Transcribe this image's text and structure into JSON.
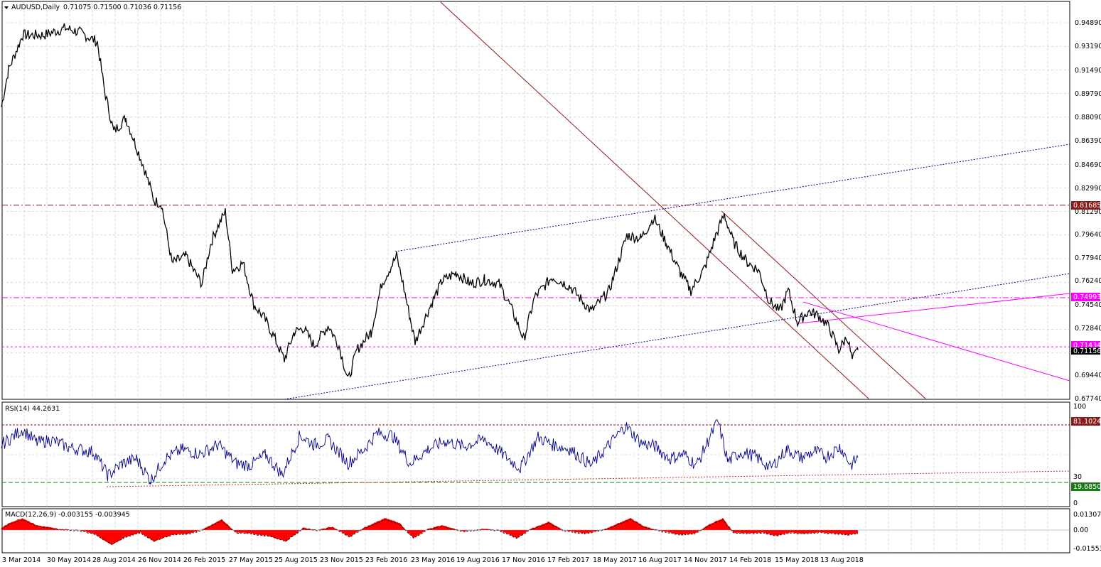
{
  "main_panel": {
    "symbol_header": "AUDUSD,Daily",
    "ohlc": "0.71075 0.71500 0.71036 0.71156",
    "price_ticks": [
      "0.94890",
      "0.93190",
      "0.91490",
      "0.89790",
      "0.88090",
      "0.86390",
      "0.84690",
      "0.82990",
      "0.81290",
      "0.79640",
      "0.77940",
      "0.76240",
      "0.74540",
      "0.72840",
      "0.69440",
      "0.67740"
    ],
    "price_tags": [
      {
        "text": "0.81685",
        "bg": "#8b1a1a",
        "fg": "#ffffff"
      },
      {
        "text": "0.74993",
        "bg": "#ff00ff",
        "fg": "#ffffff"
      },
      {
        "text": "0.71434",
        "bg": "#ff00ff",
        "fg": "#ffffff"
      },
      {
        "text": "0.71156",
        "bg": "#000000",
        "fg": "#ffffff"
      }
    ]
  },
  "rsi_panel": {
    "header": "RSI(14) 44.2631",
    "ticks": [
      "100",
      "30",
      "0"
    ],
    "tags": [
      {
        "text": "81.1024",
        "bg": "#8b1a1a",
        "fg": "#ffffff"
      },
      {
        "text": "19.6850",
        "bg": "#1a7a1a",
        "fg": "#ffffff"
      }
    ]
  },
  "macd_panel": {
    "header": "MACD(12,26,9) -0.003155 -0.003945",
    "ticks": [
      "0.013076",
      "0.00",
      "-0.015536"
    ]
  },
  "time_axis": [
    "3 Mar 2014",
    "30 May 2014",
    "28 Aug 2014",
    "26 Nov 2014",
    "26 Feb 2015",
    "27 May 2015",
    "25 Aug 2015",
    "23 Nov 2015",
    "23 Feb 2016",
    "23 May 2016",
    "19 Aug 2016",
    "17 Nov 2016",
    "17 Feb 2017",
    "18 May 2017",
    "16 Aug 2017",
    "14 Nov 2017",
    "14 Feb 2018",
    "15 May 2018",
    "13 Aug 2018"
  ],
  "colors": {
    "price_line": "#000000",
    "rsi_line": "#00008b",
    "macd_hist": "#ff0000",
    "grid": "#c0c0c0",
    "trend_dark_red": "#8b1a1a",
    "trend_blue": "#00008b",
    "trend_magenta": "#ff00ff"
  },
  "chart_data": {
    "type": "line",
    "price_anchors": [
      [
        0,
        0.888
      ],
      [
        10,
        0.915
      ],
      [
        30,
        0.94
      ],
      [
        60,
        0.94
      ],
      [
        90,
        0.945
      ],
      [
        110,
        0.942
      ],
      [
        135,
        0.935
      ],
      [
        145,
        0.9
      ],
      [
        158,
        0.87
      ],
      [
        175,
        0.88
      ],
      [
        200,
        0.845
      ],
      [
        215,
        0.82
      ],
      [
        225,
        0.818
      ],
      [
        240,
        0.775
      ],
      [
        260,
        0.78
      ],
      [
        270,
        0.77
      ],
      [
        282,
        0.76
      ],
      [
        295,
        0.79
      ],
      [
        303,
        0.8
      ],
      [
        315,
        0.812
      ],
      [
        325,
        0.77
      ],
      [
        340,
        0.775
      ],
      [
        355,
        0.745
      ],
      [
        370,
        0.735
      ],
      [
        385,
        0.72
      ],
      [
        398,
        0.705
      ],
      [
        412,
        0.725
      ],
      [
        425,
        0.728
      ],
      [
        440,
        0.715
      ],
      [
        460,
        0.73
      ],
      [
        475,
        0.715
      ],
      [
        488,
        0.69
      ],
      [
        500,
        0.712
      ],
      [
        520,
        0.725
      ],
      [
        535,
        0.76
      ],
      [
        556,
        0.78
      ],
      [
        565,
        0.76
      ],
      [
        575,
        0.735
      ],
      [
        582,
        0.718
      ],
      [
        600,
        0.74
      ],
      [
        620,
        0.762
      ],
      [
        640,
        0.768
      ],
      [
        660,
        0.76
      ],
      [
        680,
        0.763
      ],
      [
        700,
        0.76
      ],
      [
        715,
        0.745
      ],
      [
        735,
        0.72
      ],
      [
        750,
        0.75
      ],
      [
        775,
        0.765
      ],
      [
        800,
        0.758
      ],
      [
        830,
        0.74
      ],
      [
        855,
        0.755
      ],
      [
        880,
        0.795
      ],
      [
        900,
        0.793
      ],
      [
        918,
        0.808
      ],
      [
        935,
        0.79
      ],
      [
        955,
        0.768
      ],
      [
        970,
        0.755
      ],
      [
        990,
        0.772
      ],
      [
        1005,
        0.795
      ],
      [
        1017,
        0.81
      ],
      [
        1030,
        0.79
      ],
      [
        1050,
        0.775
      ],
      [
        1065,
        0.77
      ],
      [
        1080,
        0.748
      ],
      [
        1095,
        0.74
      ],
      [
        1107,
        0.755
      ],
      [
        1120,
        0.732
      ],
      [
        1135,
        0.74
      ],
      [
        1150,
        0.737
      ],
      [
        1165,
        0.728
      ],
      [
        1178,
        0.712
      ],
      [
        1190,
        0.722
      ],
      [
        1197,
        0.705
      ],
      [
        1205,
        0.712
      ]
    ],
    "rsi_anchors": [
      [
        0,
        60
      ],
      [
        15,
        68
      ],
      [
        30,
        76
      ],
      [
        50,
        62
      ],
      [
        70,
        65
      ],
      [
        95,
        57
      ],
      [
        130,
        52
      ],
      [
        150,
        27
      ],
      [
        170,
        40
      ],
      [
        190,
        45
      ],
      [
        210,
        22
      ],
      [
        230,
        45
      ],
      [
        255,
        55
      ],
      [
        280,
        50
      ],
      [
        305,
        60
      ],
      [
        330,
        40
      ],
      [
        350,
        38
      ],
      [
        372,
        49
      ],
      [
        395,
        28
      ],
      [
        420,
        70
      ],
      [
        440,
        60
      ],
      [
        460,
        65
      ],
      [
        488,
        40
      ],
      [
        510,
        55
      ],
      [
        528,
        72
      ],
      [
        550,
        70
      ],
      [
        575,
        40
      ],
      [
        600,
        55
      ],
      [
        625,
        64
      ],
      [
        650,
        58
      ],
      [
        680,
        66
      ],
      [
        705,
        50
      ],
      [
        730,
        35
      ],
      [
        755,
        68
      ],
      [
        775,
        60
      ],
      [
        800,
        55
      ],
      [
        830,
        38
      ],
      [
        855,
        60
      ],
      [
        878,
        80
      ],
      [
        900,
        62
      ],
      [
        920,
        58
      ],
      [
        940,
        45
      ],
      [
        960,
        50
      ],
      [
        978,
        38
      ],
      [
        995,
        65
      ],
      [
        1008,
        85
      ],
      [
        1022,
        42
      ],
      [
        1040,
        52
      ],
      [
        1060,
        48
      ],
      [
        1082,
        35
      ],
      [
        1105,
        55
      ],
      [
        1125,
        46
      ],
      [
        1145,
        53
      ],
      [
        1160,
        47
      ],
      [
        1180,
        58
      ],
      [
        1195,
        38
      ],
      [
        1205,
        46
      ]
    ],
    "macd_anchors": [
      [
        0,
        0.002
      ],
      [
        15,
        0.007
      ],
      [
        30,
        0.01
      ],
      [
        50,
        0.004
      ],
      [
        80,
        0.001
      ],
      [
        110,
        0.0
      ],
      [
        130,
        -0.003
      ],
      [
        155,
        -0.013
      ],
      [
        175,
        -0.006
      ],
      [
        195,
        -0.002
      ],
      [
        215,
        -0.01
      ],
      [
        240,
        -0.004
      ],
      [
        265,
        -0.003
      ],
      [
        285,
        0.001
      ],
      [
        310,
        0.009
      ],
      [
        330,
        -0.002
      ],
      [
        350,
        -0.003
      ],
      [
        375,
        -0.005
      ],
      [
        400,
        -0.01
      ],
      [
        425,
        0.002
      ],
      [
        445,
        0.0
      ],
      [
        465,
        0.003
      ],
      [
        490,
        -0.006
      ],
      [
        510,
        0.002
      ],
      [
        540,
        0.01
      ],
      [
        560,
        0.006
      ],
      [
        580,
        -0.007
      ],
      [
        600,
        0.001
      ],
      [
        620,
        0.004
      ],
      [
        650,
        -0.001
      ],
      [
        680,
        0.001
      ],
      [
        700,
        0.0
      ],
      [
        725,
        -0.007
      ],
      [
        745,
        0.001
      ],
      [
        770,
        0.007
      ],
      [
        790,
        0.0
      ],
      [
        820,
        -0.003
      ],
      [
        850,
        0.001
      ],
      [
        885,
        0.01
      ],
      [
        905,
        0.003
      ],
      [
        930,
        -0.001
      ],
      [
        955,
        -0.004
      ],
      [
        975,
        -0.003
      ],
      [
        1000,
        0.006
      ],
      [
        1015,
        0.01
      ],
      [
        1030,
        -0.002
      ],
      [
        1050,
        -0.003
      ],
      [
        1070,
        -0.002
      ],
      [
        1090,
        -0.005
      ],
      [
        1110,
        -0.002
      ],
      [
        1130,
        -0.003
      ],
      [
        1150,
        -0.002
      ],
      [
        1170,
        -0.003
      ],
      [
        1190,
        -0.004
      ],
      [
        1205,
        -0.003
      ]
    ],
    "levels": {
      "resistance": 0.81685,
      "pink_horizontal": 0.74993,
      "pink_dashed": 0.71434,
      "current": 0.71156,
      "rsi_upper": 81.1024,
      "rsi_lower": 19.685
    },
    "price_range": [
      0.6774,
      0.9489
    ],
    "rsi_range": [
      0,
      100
    ],
    "macd_range": [
      -0.015536,
      0.013076
    ]
  }
}
